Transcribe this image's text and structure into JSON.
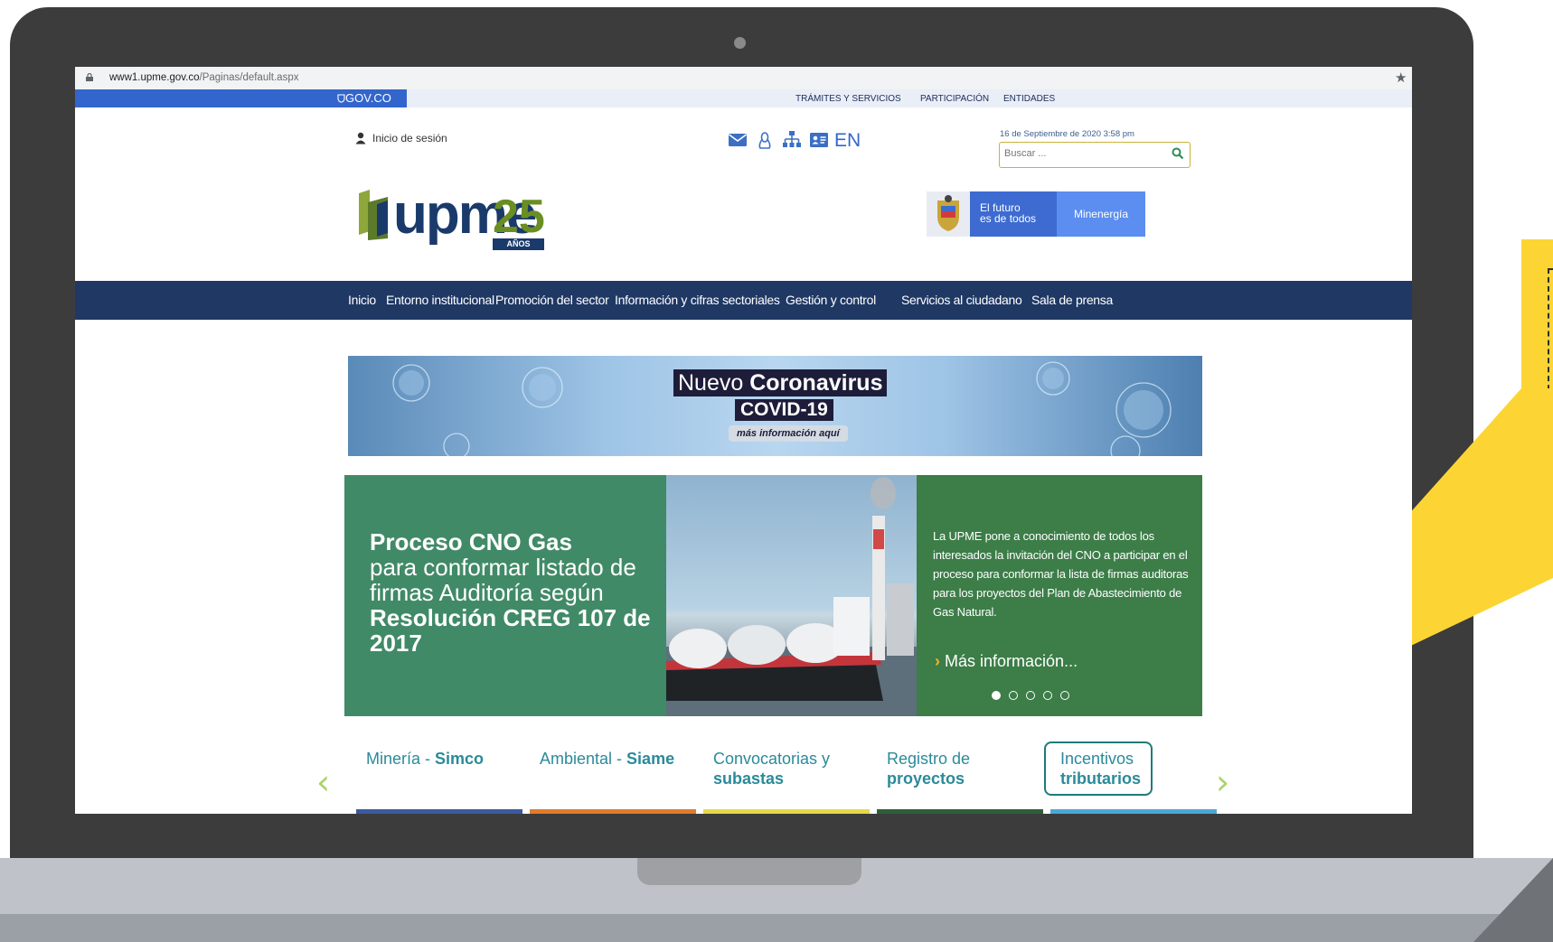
{
  "browser": {
    "url_host": "www1.upme.gov.co",
    "url_path": "/Paginas/default.aspx"
  },
  "gov_bar": {
    "logo": "GOV.CO",
    "links": [
      "TRÁMITES Y SERVICIOS",
      "PARTICIPACIÓN",
      "ENTIDADES"
    ]
  },
  "header": {
    "login_label": "Inicio de sesión",
    "language": "EN",
    "date": "16 de Septiembre de 2020 3:58 pm",
    "search_placeholder": "Buscar ...",
    "tool_icons": [
      "envelope-icon",
      "linux-icon",
      "sitemap-icon",
      "id-card-icon"
    ]
  },
  "logo": {
    "text": "upme",
    "number": "25",
    "years": "AÑOS"
  },
  "gov_banner": {
    "future_line1": "El futuro",
    "future_line2": "es de todos",
    "ministry": "Minenergía"
  },
  "nav": {
    "items": [
      "Inicio",
      "Entorno institucional",
      "Promoción del sector",
      "Información y cifras sectoriales",
      "Gestión y control",
      "Servicios al ciudadano",
      "Sala de prensa"
    ]
  },
  "covid_banner": {
    "line1_light": "Nuevo ",
    "line1_bold": "Coronavirus",
    "line2": "COVID-19",
    "line3": "más información aquí"
  },
  "slider": {
    "title_bold1": "Proceso CNO Gas",
    "title_light": "para conformar listado de firmas Auditoría según ",
    "title_bold2": "Resolución CREG 107 de 2017",
    "description": "La UPME pone a conocimiento de todos los interesados la invitación del CNO a participar en el proceso para conformar la lista de firmas auditoras para los proyectos del Plan de Abastecimiento de Gas Natural.",
    "more_link": "Más información...",
    "dot_count": 5,
    "active_dot": 1
  },
  "tiles": [
    {
      "light": "Minería - ",
      "bold": "Simco",
      "bar_color": "#3b5aa0"
    },
    {
      "light": "Ambiental - ",
      "bold": "Siame",
      "bar_color": "#e07b2c"
    },
    {
      "light": "Convocatorias y",
      "bold": "subastas",
      "bar_color": "#e6d94a"
    },
    {
      "light": "Registro de",
      "bold": "proyectos",
      "bar_color": "#2f5e3a"
    },
    {
      "light": "Incentivos",
      "bold": "tributarios",
      "bar_color": "#4aa8d8"
    }
  ],
  "colors": {
    "nav_bg": "#1f3864",
    "gov_blue": "#3366cc",
    "slide_green": "#418a67",
    "callout_yellow": "#fcd535"
  }
}
